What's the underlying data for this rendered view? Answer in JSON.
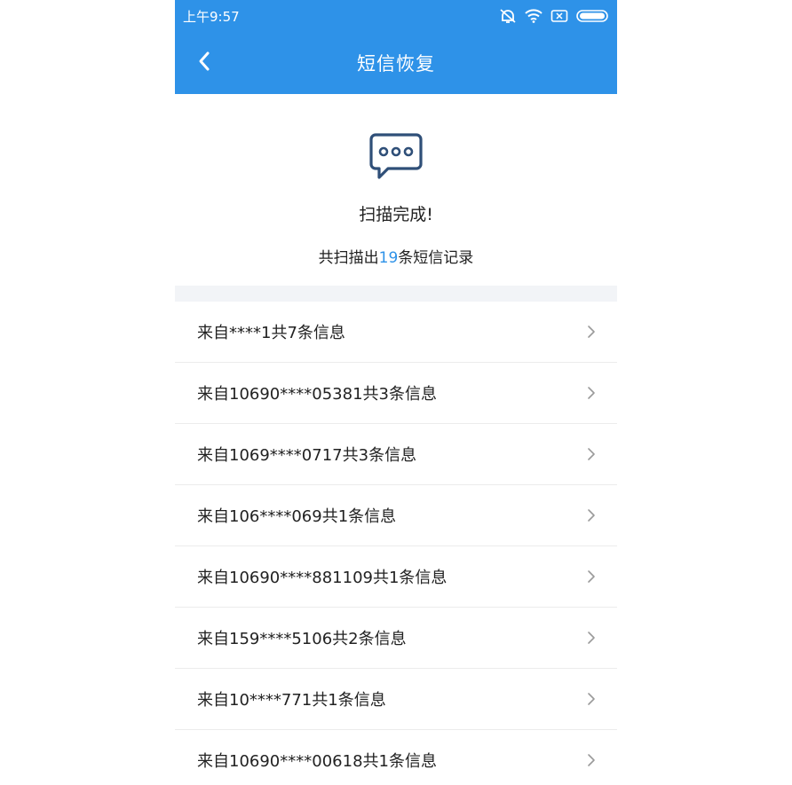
{
  "status_bar": {
    "time": "上午9:57",
    "icons": [
      "alarm-off-icon",
      "wifi-icon",
      "sim-icon",
      "battery-icon"
    ],
    "color": "#2e92e8"
  },
  "app_bar": {
    "back_icon": "chevron-left-icon",
    "title": "短信恢复"
  },
  "summary": {
    "icon": "message-bubble-icon",
    "title": "扫描完成!",
    "count_prefix": "共扫描出",
    "count": "19",
    "count_suffix": "条短信记录"
  },
  "list": {
    "items": [
      {
        "label": "来自****1共7条信息"
      },
      {
        "label": "来自10690****05381共3条信息"
      },
      {
        "label": "来自1069****0717共3条信息"
      },
      {
        "label": "来自106****069共1条信息"
      },
      {
        "label": "来自10690****881109共1条信息"
      },
      {
        "label": "来自159****5106共2条信息"
      },
      {
        "label": "来自10****771共1条信息"
      },
      {
        "label": "来自10690****00618共1条信息"
      }
    ],
    "chevron_icon": "chevron-right-icon"
  }
}
